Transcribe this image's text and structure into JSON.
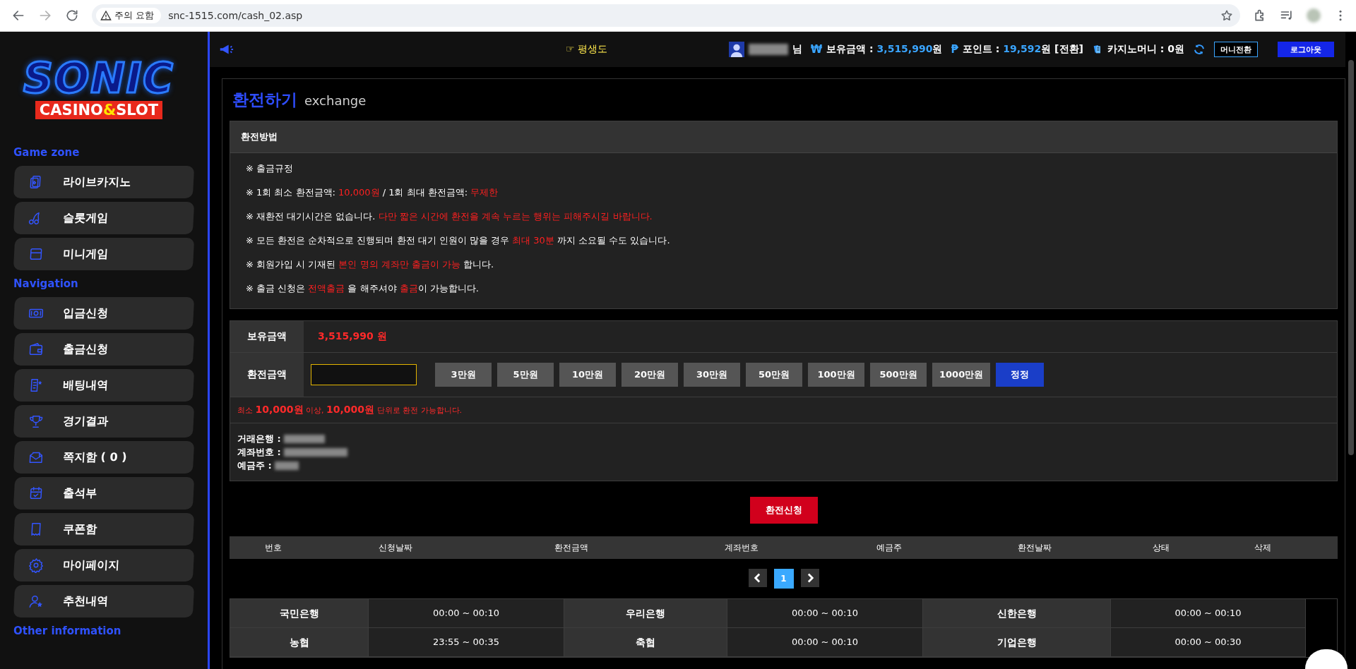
{
  "browser": {
    "security_label": "주의 요함",
    "url": "snc-1515.com/cash_02.asp"
  },
  "sidebar": {
    "logo": {
      "title": "SONIC",
      "subtitle": [
        {
          "text": "CASINO",
          "highlight": false
        },
        {
          "text": "&",
          "highlight": true
        },
        {
          "text": "SLOT",
          "highlight": false
        }
      ]
    },
    "sections": [
      {
        "title": "Game zone",
        "items": [
          {
            "label": "라이브카지노"
          },
          {
            "label": "슬롯게임"
          },
          {
            "label": "미니게임"
          }
        ]
      },
      {
        "title": "Navigation",
        "items": [
          {
            "label": "입금신청"
          },
          {
            "label": "출금신청"
          },
          {
            "label": "배팅내역"
          },
          {
            "label": "경기결과"
          },
          {
            "label": "쪽지함 ( 0 )"
          },
          {
            "label": "출석부"
          },
          {
            "label": "쿠폰함"
          },
          {
            "label": "마이페이지"
          },
          {
            "label": "추천내역"
          }
        ]
      },
      {
        "title": "Other information"
      }
    ]
  },
  "topbar": {
    "notice": "☞ 평생도",
    "user_suffix": "님",
    "stats": [
      {
        "symbol": "₩",
        "label": "보유금액 :",
        "value": "3,515,990",
        "unit": "원"
      },
      {
        "symbol": "₱",
        "label": "포인트 :",
        "value": "19,592",
        "unit": "원 [전환]"
      },
      {
        "label": "카지노머니 : 0원"
      }
    ],
    "buttons": [
      {
        "label": "머니전환",
        "kind": "outline"
      },
      {
        "label": "로그아웃",
        "kind": "primary"
      }
    ]
  },
  "page": {
    "title": "환전하기",
    "subtitle": "exchange",
    "rules": {
      "title": "환전방법",
      "lines": [
        [
          {
            "text": "※ 출금규정",
            "highlight": false
          }
        ],
        [
          {
            "text": "※ 1회 최소 환전금액: ",
            "highlight": false
          },
          {
            "text": "10,000원",
            "highlight": true
          },
          {
            "text": " / 1회 최대 환전금액: ",
            "highlight": false
          },
          {
            "text": "무제한",
            "highlight": true
          }
        ],
        [
          {
            "text": "※ 재환전 대기시간은 없습니다. ",
            "highlight": false
          },
          {
            "text": "다만 짧은 시간에 환전을 계속 누르는 행위는 피해주시길 바랍니다.",
            "highlight": true
          }
        ],
        [
          {
            "text": "※ 모든 환전은 순차적으로 진행되며 환전 대기 인원이 많을 경우 ",
            "highlight": false
          },
          {
            "text": "최대 30분",
            "highlight": true
          },
          {
            "text": " 까지 소요될 수도 있습니다.",
            "highlight": false
          }
        ],
        [
          {
            "text": "※ 회원가입 시 기재된 ",
            "highlight": false
          },
          {
            "text": "본인 명의 계좌만 출금이 가능",
            "highlight": true
          },
          {
            "text": " 합니다.",
            "highlight": false
          }
        ],
        [
          {
            "text": "※ 출금 신청은 ",
            "highlight": false
          },
          {
            "text": "전액출금",
            "highlight": true
          },
          {
            "text": " 을 해주셔야 ",
            "highlight": false
          },
          {
            "text": "출금",
            "highlight": true
          },
          {
            "text": "이 가능합니다.",
            "highlight": false
          }
        ]
      ]
    },
    "form": {
      "balance_label": "보유금액",
      "balance_value": "3,515,990 원",
      "amount_label": "환전금액",
      "amount_buttons": [
        {
          "label": "3만원",
          "kind": "amount"
        },
        {
          "label": "5만원",
          "kind": "amount"
        },
        {
          "label": "10만원",
          "kind": "amount"
        },
        {
          "label": "20만원",
          "kind": "amount"
        },
        {
          "label": "30만원",
          "kind": "amount"
        },
        {
          "label": "50만원",
          "kind": "amount"
        },
        {
          "label": "100만원",
          "kind": "amount"
        },
        {
          "label": "500만원",
          "kind": "amount"
        },
        {
          "label": "1000만원",
          "kind": "amount"
        },
        {
          "label": "정정",
          "kind": "reset"
        }
      ],
      "note": "최소 **10,000원** 이상, **10,000원**  단위로 환전 가능합니다.",
      "account_labels": [
        "거래은행 :",
        "계좌번호 :",
        "예금주 :"
      ]
    },
    "submit": "환전신청",
    "table": {
      "columns": [
        "번호",
        "신청날짜",
        "환전금액",
        "계좌번호",
        "예금주",
        "환전날짜",
        "상태",
        "삭제"
      ]
    },
    "pagination": {
      "pages": [
        {
          "label": "1",
          "selected": true
        }
      ]
    },
    "bank_hours": [
      [
        {
          "bank": "국민은행",
          "hours": "00:00 ~ 00:10"
        },
        {
          "bank": "우리은행",
          "hours": "00:00 ~ 00:10"
        },
        {
          "bank": "신한은행",
          "hours": "00:00 ~ 00:10"
        }
      ],
      [
        {
          "bank": "농협",
          "hours": "23:55 ~ 00:35"
        },
        {
          "bank": "축협",
          "hours": "00:00 ~ 00:10"
        },
        {
          "bank": "기업은행",
          "hours": "00:00 ~ 00:30"
        }
      ]
    ]
  }
}
